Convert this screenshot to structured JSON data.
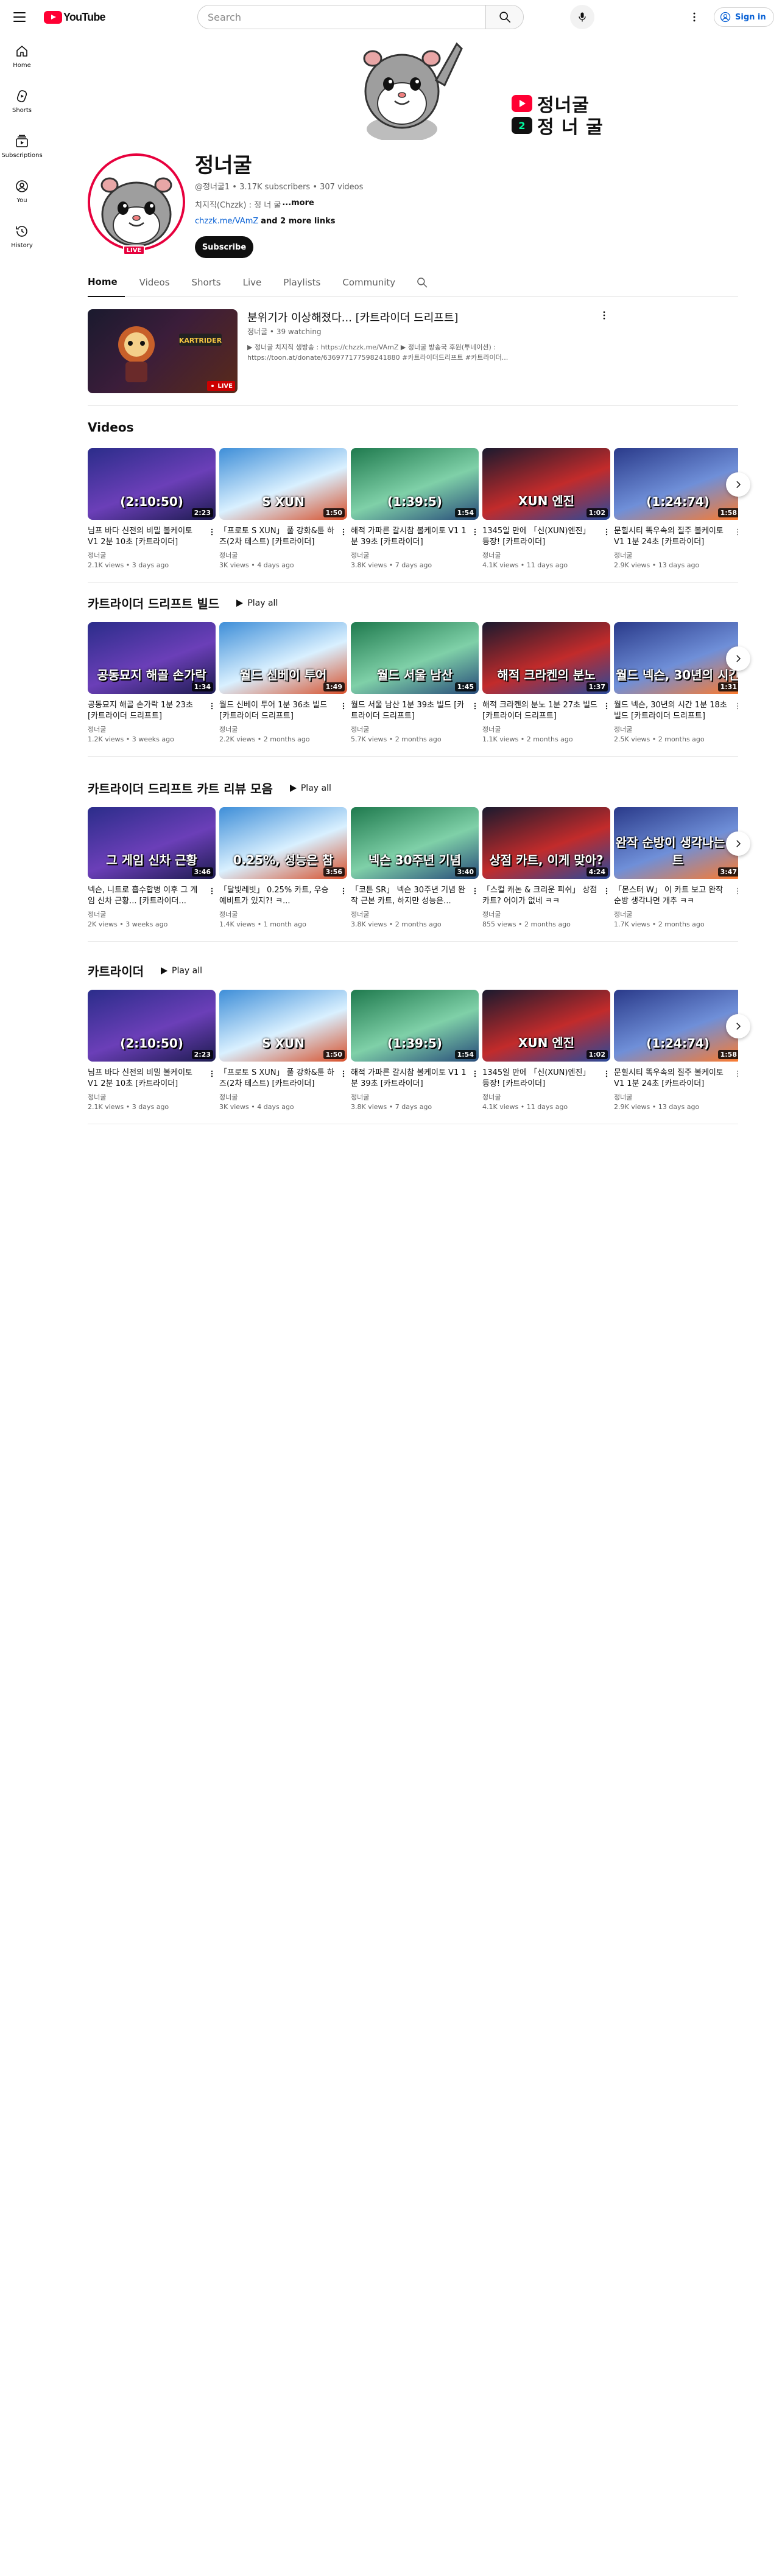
{
  "masthead": {
    "logo_text": "YouTube",
    "search_placeholder": "Search",
    "signin_label": "Sign in"
  },
  "guide": [
    {
      "label": "Home",
      "icon": "home-icon"
    },
    {
      "label": "Shorts",
      "icon": "shorts-icon"
    },
    {
      "label": "Subscriptions",
      "icon": "subscriptions-icon"
    },
    {
      "label": "You",
      "icon": "you-icon"
    },
    {
      "label": "History",
      "icon": "history-icon"
    }
  ],
  "banner": {
    "line1": "정너굴",
    "line2": "정 너 굴",
    "badge2": "2"
  },
  "channel": {
    "name": "정너굴",
    "meta": "@정너굴1 • 3.17K subscribers • 307 videos",
    "desc": "치지직(Chzzk) : 정 너 굴",
    "desc_more": "...more",
    "link": "chzzk.me/VAmZ",
    "link_more": " and 2 more links",
    "subscribe_label": "Subscribe",
    "live_label": "LIVE"
  },
  "tabs": [
    "Home",
    "Videos",
    "Shorts",
    "Live",
    "Playlists",
    "Community"
  ],
  "featured": {
    "title": "분위기가 이상해졌다... [카트라이더 드리프트]",
    "meta": "정너굴 • 39 watching",
    "desc_line1": "▶ 정너굴 치지직 생방송 : https://chzzk.me/VAmZ ▶ 정너굴 방송국 후원(투네이션) :",
    "desc_line2": "https://toon.at/donate/636977177598241880 #카트라이더드리프트 #카트라이더...",
    "live_label": "LIVE"
  },
  "shelves": [
    {
      "title": "Videos",
      "play_all": "",
      "cards": [
        {
          "title": "님프 바다 신전의 비밀 볼케이토 V1 2분 10초 [카트라이더]",
          "channel": "정너굴",
          "meta": "2.1K views • 3 days ago",
          "duration": "2:23",
          "big": "(2:10:50)"
        },
        {
          "title": "「프로토 S XUN」 풀 강화&튠 하즈(2차 테스트) [카트라이더]",
          "channel": "정너굴",
          "meta": "3K views • 4 days ago",
          "duration": "1:50",
          "big": "S XUN"
        },
        {
          "title": "해적 가파른 갈시참 볼케이토 V1 1분 39초 [카트라이더]",
          "channel": "정너굴",
          "meta": "3.8K views • 7 days ago",
          "duration": "1:54",
          "big": "(1:39:5)"
        },
        {
          "title": "1345일 만에 「신(XUN)엔진」 등장! [카트라이더]",
          "channel": "정너굴",
          "meta": "4.1K views • 11 days ago",
          "duration": "1:02",
          "big": "XUN 엔진"
        },
        {
          "title": "문힐시티 똑우속의 질주 볼케이토 V1 1분 24초 [카트라이더]",
          "channel": "정너굴",
          "meta": "2.9K views • 13 days ago",
          "duration": "1:58",
          "big": "(1:24:74)"
        }
      ]
    },
    {
      "title": "카트라이더 드리프트 빌드",
      "play_all": "Play all",
      "cards": [
        {
          "title": "공동묘지 해골 손가락 1분 23초 [카트라이더 드리프트]",
          "channel": "정너굴",
          "meta": "1.2K views • 3 weeks ago",
          "duration": "1:34",
          "big": "공동묘지 해골 손가락"
        },
        {
          "title": "월드 신베이 투어 1분 36초 빌드 [카트라이더 드리프트]",
          "channel": "정너굴",
          "meta": "2.2K views • 2 months ago",
          "duration": "1:49",
          "big": "월드 신베이 투어"
        },
        {
          "title": "월드 서울 남산 1분 39초 빌드 [카트라이더 드리프트]",
          "channel": "정너굴",
          "meta": "5.7K views • 2 months ago",
          "duration": "1:45",
          "big": "월드 서울 남산"
        },
        {
          "title": "해적 크라켄의 분노 1분 27초 빌드 [카트라이더 드리프트]",
          "channel": "정너굴",
          "meta": "1.1K views • 2 months ago",
          "duration": "1:37",
          "big": "해적 크라켄의 분노"
        },
        {
          "title": "월드 넥슨, 30년의 시간 1분 18초 빌드 [카트라이더 드리프트]",
          "channel": "정너굴",
          "meta": "2.5K views • 2 months ago",
          "duration": "1:31",
          "big": "월드 넥슨, 30년의 시간"
        }
      ]
    },
    {
      "title": "카트라이더 드리프트 카트 리뷰 모음",
      "play_all": "Play all",
      "cards": [
        {
          "title": "넥슨, 니트로 흡수합병 이후 그 게임 신차 근황... [카트라이더...",
          "channel": "정너굴",
          "meta": "2K views • 3 weeks ago",
          "duration": "3:46",
          "big": "그 게임 신차 근황"
        },
        {
          "title": "「달빛레빗」 0.25% 카트, 우승 예비트가 있지?! ㅋ...",
          "channel": "정너굴",
          "meta": "1.4K views • 1 month ago",
          "duration": "3:56",
          "big": "0.25%, 성능은 참"
        },
        {
          "title": "「코튼 SR」 넥슨 30주년 기념 완작 근본 카트, 하지만 성능은...",
          "channel": "정너굴",
          "meta": "3.8K views • 2 months ago",
          "duration": "3:40",
          "big": "넥슨 30주년 기념"
        },
        {
          "title": "「스컬 캐논 & 크리운 피쉬」 상점 카트? 어이가 없네 ㅋㅋ",
          "channel": "정너굴",
          "meta": "855 views • 2 months ago",
          "duration": "4:24",
          "big": "상점 카트, 이게 맞아?"
        },
        {
          "title": "「몬스터 W」 이 카트 보고 완작 순방 생각나면 개추 ㅋㅋ",
          "channel": "정너굴",
          "meta": "1.7K views • 2 months ago",
          "duration": "3:47",
          "big": "완작 순방이 생각나는 카트"
        }
      ]
    },
    {
      "title": "카트라이더",
      "play_all": "Play all",
      "cards": [
        {
          "title": "님프 바다 신전의 비밀 볼케이토 V1 2분 10초 [카트라이더]",
          "channel": "정너굴",
          "meta": "2.1K views • 3 days ago",
          "duration": "2:23",
          "big": "(2:10:50)"
        },
        {
          "title": "「프로토 S XUN」 풀 강화&튠 하즈(2차 테스트) [카트라이더]",
          "channel": "정너굴",
          "meta": "3K views • 4 days ago",
          "duration": "1:50",
          "big": "S XUN"
        },
        {
          "title": "해적 가파른 갈시참 볼케이토 V1 1분 39초 [카트라이더]",
          "channel": "정너굴",
          "meta": "3.8K views • 7 days ago",
          "duration": "1:54",
          "big": "(1:39:5)"
        },
        {
          "title": "1345일 만에 「신(XUN)엔진」 등장! [카트라이더]",
          "channel": "정너굴",
          "meta": "4.1K views • 11 days ago",
          "duration": "1:02",
          "big": "XUN 엔진"
        },
        {
          "title": "문힐시티 똑우속의 질주 볼케이토 V1 1분 24초 [카트라이더]",
          "channel": "정너굴",
          "meta": "2.9K views • 13 days ago",
          "duration": "1:58",
          "big": "(1:24:74)"
        }
      ]
    }
  ],
  "colors": {
    "brand_red": "#ff0033",
    "live_red": "#e7003d",
    "link_blue": "#065fd4",
    "meta_gray": "#606060"
  }
}
